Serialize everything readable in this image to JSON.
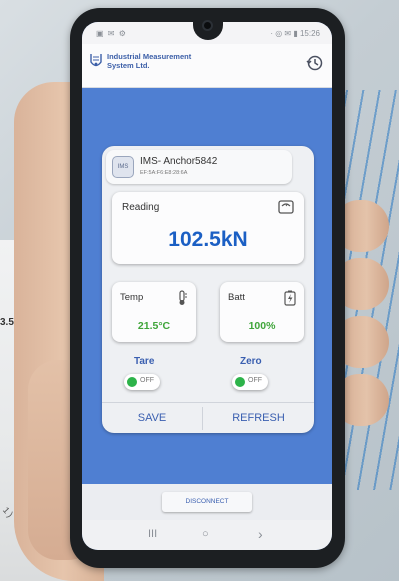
{
  "background": {
    "paper_fragment_text": "3.5",
    "scribble_text": "- 1)"
  },
  "status_bar": {
    "left_icons": "▣ ✉ ⚙",
    "right_text": "· ◎ ✉ ▮ 15:26"
  },
  "app_bar": {
    "company_name": "Industrial Measurement System Ltd.",
    "logo_icon": "ims-logo-icon",
    "history_icon": "history-icon"
  },
  "device": {
    "badge": "IMS",
    "name": "IMS- Anchor5842",
    "mac": "EF:5A:F6:E8:28:6A"
  },
  "reading": {
    "label": "Reading",
    "value": "102.5kN",
    "icon": "scale-icon"
  },
  "temp": {
    "label": "Temp",
    "value": "21.5°C",
    "icon": "thermometer-icon"
  },
  "battery": {
    "label": "Batt",
    "value": "100%",
    "icon": "battery-icon"
  },
  "tare": {
    "label": "Tare",
    "state": "OFF"
  },
  "zero": {
    "label": "Zero",
    "state": "OFF"
  },
  "actions": {
    "save": "SAVE",
    "refresh": "REFRESH"
  },
  "disconnect": {
    "label": "DISCONNECT"
  },
  "navbar": {
    "recents": "III",
    "home": "○",
    "back": "›"
  },
  "colors": {
    "primary_blue": "#1b5fc4",
    "screen_background": "#4f7fd2",
    "value_green": "#3fa53a",
    "toggle_green": "#2db34a"
  }
}
